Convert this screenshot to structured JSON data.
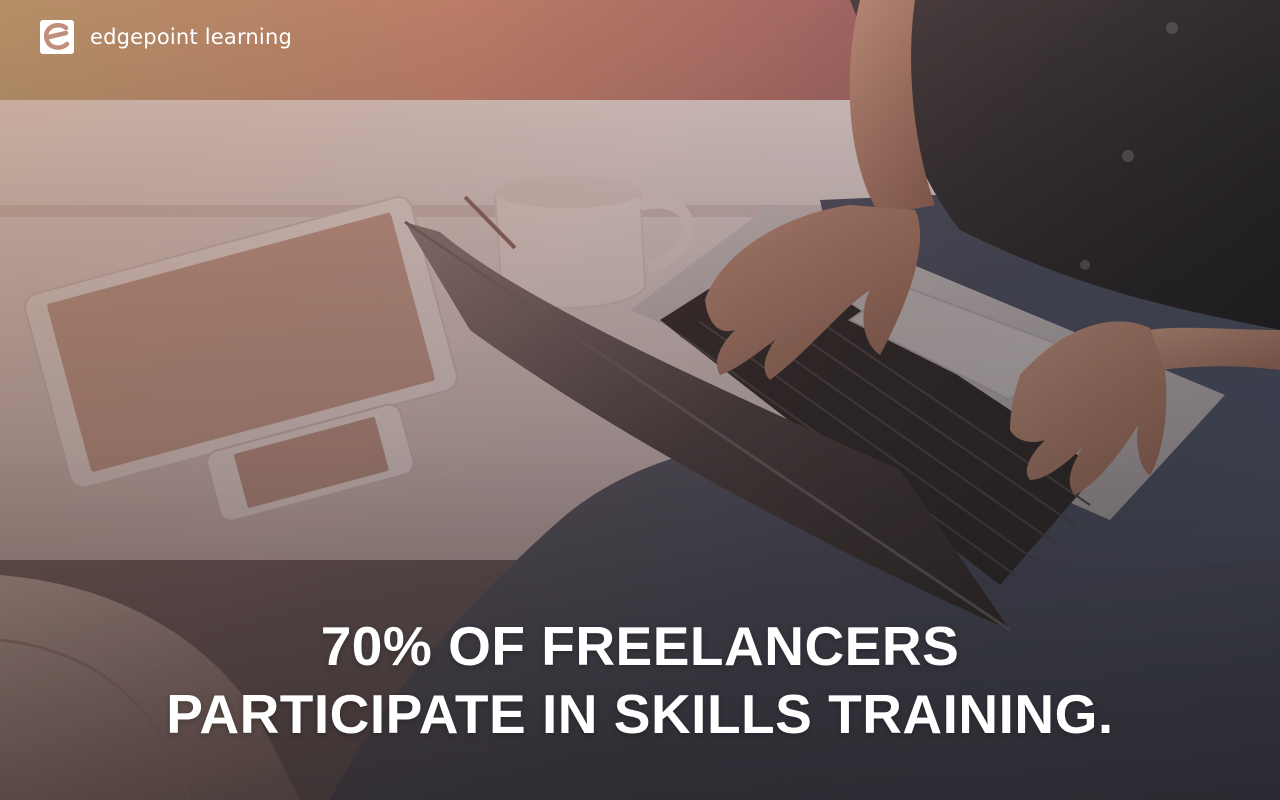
{
  "brand": {
    "name": "edgepoint learning",
    "logo_icon": "edgepoint-e-logo-icon"
  },
  "headline": {
    "line1": "70% OF FREELANCERS",
    "line2": "PARTICIPATE IN SKILLS TRAINING."
  },
  "colors": {
    "text": "#ffffff",
    "overlay_warm": "#d98a5a",
    "overlay_dark": "#2e2a2b"
  }
}
